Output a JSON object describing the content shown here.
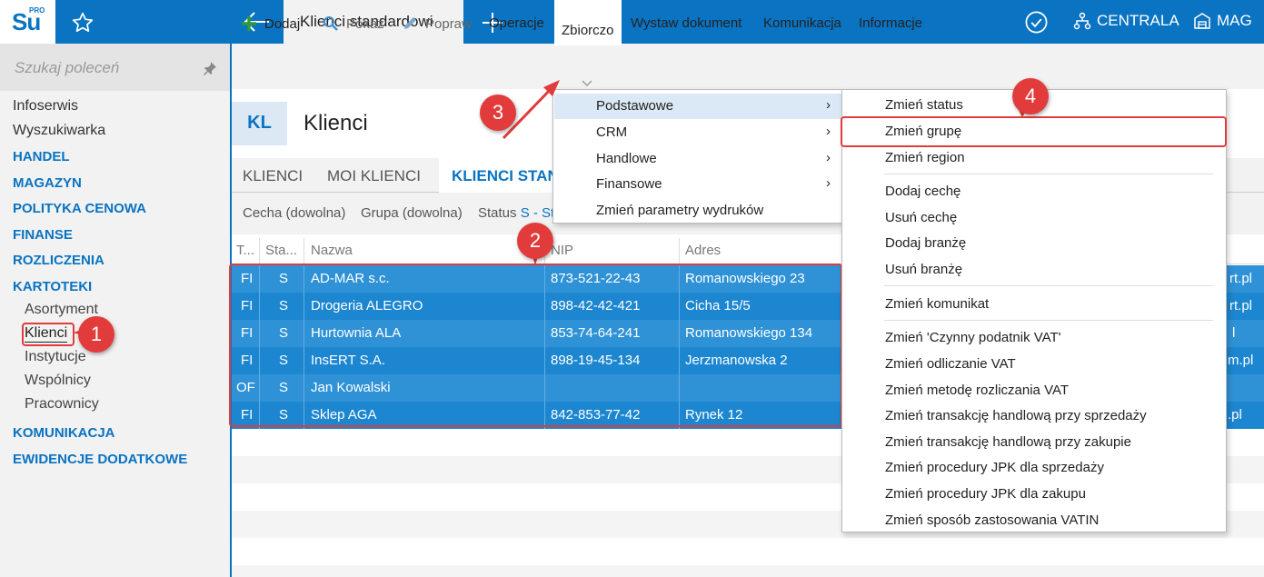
{
  "app": {
    "logo_text": "Su",
    "logo_sup": "PRO",
    "active_tab": "Klienci standardowi",
    "centrala": "CENTRALA",
    "mag": "MAG"
  },
  "sidebar": {
    "search_placeholder": "Szukaj poleceń",
    "items": [
      "Infoserwis",
      "Wyszukiwarka"
    ],
    "sections": [
      "HANDEL",
      "MAGAZYN",
      "POLITYKA CENOWA",
      "FINANSE",
      "ROZLICZENIA",
      "KARTOTEKI"
    ],
    "kartoteki_items": [
      "Asortyment",
      "Klienci",
      "Instytucje",
      "Wspólnicy",
      "Pracownicy"
    ],
    "sections_after": [
      "KOMUNIKACJA",
      "EWIDENCJE DODATKOWE"
    ]
  },
  "toolbar": {
    "add": "Dodaj",
    "show": "Pokaż",
    "edit": "Popraw",
    "operations": "Operacje",
    "bulk": "Zbiorczo",
    "issue_doc": "Wystaw dokument",
    "communication": "Komunikacja",
    "info": "Informacje"
  },
  "header": {
    "badge": "KL",
    "title": "Klienci"
  },
  "subtabs": [
    "KLIENCI",
    "MOI KLIENCI",
    "KLIENCI STAN"
  ],
  "filters": {
    "feature": "Cecha (dowolna)",
    "group": "Grupa (dowolna)",
    "status_label": "Status",
    "status_value": "S - St"
  },
  "table": {
    "columns": [
      "T...",
      "Sta...",
      "Nazwa",
      "NIP",
      "Adres"
    ],
    "rows": [
      {
        "type": "FI",
        "status": "S",
        "name": "AD-MAR s.c.",
        "nip": "873-521-22-43",
        "address": "Romanowskiego 23",
        "extra": "rt.pl"
      },
      {
        "type": "FI",
        "status": "S",
        "name": "Drogeria ALEGRO",
        "nip": "898-42-42-421",
        "address": "Cicha  15/5",
        "extra": "rt.pl"
      },
      {
        "type": "FI",
        "status": "S",
        "name": "Hurtownia ALA",
        "nip": "853-74-64-241",
        "address": "Romanowskiego 134",
        "extra": "l"
      },
      {
        "type": "FI",
        "status": "S",
        "name": "InsERT S.A.",
        "nip": "898-19-45-134",
        "address": "Jerzmanowska 2",
        "extra": "m.pl"
      },
      {
        "type": "OF",
        "status": "S",
        "name": "Jan Kowalski",
        "nip": "",
        "address": "",
        "extra": ""
      },
      {
        "type": "FI",
        "status": "S",
        "name": "Sklep AGA",
        "nip": "842-853-77-42",
        "address": "Rynek 12",
        "extra": ".pl"
      }
    ]
  },
  "menu_zbiorczo": {
    "items": [
      "Podstawowe",
      "CRM",
      "Handlowe",
      "Finansowe",
      "Zmień parametry wydruków"
    ],
    "arrow": "›"
  },
  "menu_podstawowe": {
    "items": [
      "Zmień status",
      "Zmień grupę",
      "Zmień region",
      "Dodaj cechę",
      "Usuń cechę",
      "Dodaj branżę",
      "Usuń branżę",
      "Zmień komunikat",
      "Zmień 'Czynny podatnik VAT'",
      "Zmień odliczanie VAT",
      "Zmień metodę rozliczania VAT",
      "Zmień transakcję handlową przy sprzedaży",
      "Zmień transakcję handlową przy zakupie",
      "Zmień procedury JPK dla sprzedaży",
      "Zmień procedury JPK dla zakupu",
      "Zmień sposób zastosowania VATIN"
    ]
  },
  "callouts": [
    "1",
    "2",
    "3",
    "4"
  ],
  "colors": {
    "accent": "#0a73c2",
    "selection": "#2f92d6",
    "callout": "#e23b3b"
  }
}
